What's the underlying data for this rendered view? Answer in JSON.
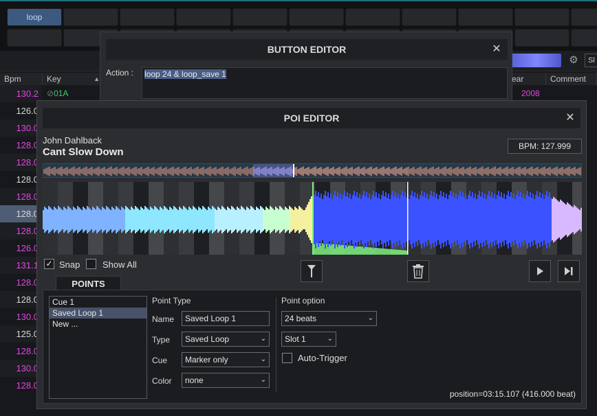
{
  "background": {
    "active_pad_label": "loop",
    "settings_short": "Sl",
    "columns": {
      "bpm": "Bpm",
      "key": "Key",
      "year": "ear",
      "comment": "Comment"
    },
    "sort_indicator": "▲",
    "rows": [
      {
        "bpm": "130.2",
        "color": "pink"
      },
      {
        "bpm": "126.0",
        "color": "white"
      },
      {
        "bpm": "130.0",
        "color": "pink"
      },
      {
        "bpm": "128.0",
        "color": "pink"
      },
      {
        "bpm": "128.0",
        "color": "pink"
      },
      {
        "bpm": "128.0",
        "color": "white"
      },
      {
        "bpm": "128.0",
        "color": "pink"
      },
      {
        "bpm": "128.0",
        "color": "white"
      },
      {
        "bpm": "128.0",
        "color": "pink"
      },
      {
        "bpm": "126.0",
        "color": "pink"
      },
      {
        "bpm": "131.1",
        "color": "pink"
      },
      {
        "bpm": "128.0",
        "color": "pink"
      },
      {
        "bpm": "128.0",
        "color": "white"
      },
      {
        "bpm": "130.0",
        "color": "pink"
      },
      {
        "bpm": "125.0",
        "color": "white"
      },
      {
        "bpm": "128.0",
        "color": "pink"
      },
      {
        "bpm": "130.0",
        "color": "pink"
      },
      {
        "bpm": "128.0",
        "color": "pink"
      }
    ],
    "first_row_key": "01A",
    "first_row_year": "2008"
  },
  "button_editor": {
    "title": "BUTTON EDITOR",
    "action_label": "Action :",
    "action_value": "loop 24 & loop_save 1"
  },
  "poi_editor": {
    "title": "POI EDITOR",
    "artist": "John Dahlback",
    "track": "Cant Slow Down",
    "bpm": "BPM: 127.999",
    "snap_label": "Snap",
    "snap_checked": true,
    "show_all_label": "Show All",
    "show_all_checked": false,
    "tab": "POINTS",
    "points": [
      "Cue 1",
      "Saved Loop 1",
      "New ..."
    ],
    "selected_point": 1,
    "point_type": {
      "header": "Point Type",
      "name_label": "Name",
      "name_value": "Saved Loop 1",
      "type_label": "Type",
      "type_value": "Saved Loop",
      "cue_label": "Cue",
      "cue_value": "Marker only",
      "color_label": "Color",
      "color_value": "none"
    },
    "point_option": {
      "header": "Point option",
      "beats_value": "24 beats",
      "slot_value": "Slot 1",
      "auto_trigger_label": "Auto-Trigger",
      "auto_trigger_checked": false
    },
    "position": "position=03:15.107 (416.000 beat)",
    "colors": {
      "accent": "#4a5d86",
      "wave_blue": "#3a52ff",
      "loop_green": "#7ef07e"
    }
  }
}
